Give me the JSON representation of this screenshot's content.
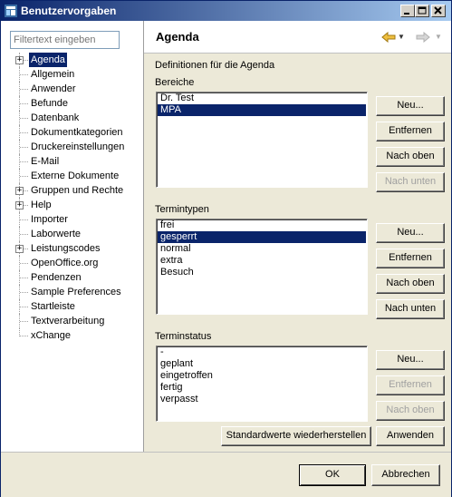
{
  "window": {
    "title": "Benutzervorgaben"
  },
  "filter": {
    "placeholder": "Filtertext eingeben"
  },
  "tree": [
    {
      "label": "Agenda",
      "expandable": true,
      "selected": true
    },
    {
      "label": "Allgemein"
    },
    {
      "label": "Anwender"
    },
    {
      "label": "Befunde"
    },
    {
      "label": "Datenbank"
    },
    {
      "label": "Dokumentkategorien"
    },
    {
      "label": "Druckereinstellungen"
    },
    {
      "label": "E-Mail"
    },
    {
      "label": "Externe Dokumente"
    },
    {
      "label": "Gruppen und Rechte",
      "expandable": true
    },
    {
      "label": "Help",
      "expandable": true
    },
    {
      "label": "Importer"
    },
    {
      "label": "Laborwerte"
    },
    {
      "label": "Leistungscodes",
      "expandable": true
    },
    {
      "label": "OpenOffice.org"
    },
    {
      "label": "Pendenzen"
    },
    {
      "label": "Sample Preferences"
    },
    {
      "label": "Startleiste"
    },
    {
      "label": "Textverarbeitung"
    },
    {
      "label": "xChange"
    }
  ],
  "page": {
    "title": "Agenda",
    "description": "Definitionen für die Agenda",
    "bereiche": {
      "label": "Bereiche",
      "items": [
        "Dr. Test",
        "MPA"
      ],
      "selected": 1
    },
    "termintypen": {
      "label": "Termintypen",
      "items": [
        "frei",
        "gesperrt",
        "normal",
        "extra",
        "Besuch"
      ],
      "selected": 1
    },
    "terminstatus": {
      "label": "Terminstatus",
      "items": [
        "-",
        "geplant",
        "eingetroffen",
        "fertig",
        "verpasst"
      ],
      "selected": -1
    },
    "buttons": {
      "new": "Neu...",
      "remove": "Entfernen",
      "up": "Nach oben",
      "down": "Nach unten"
    },
    "restore_defaults": "Standardwerte wiederherstellen",
    "apply": "Anwenden"
  },
  "footer": {
    "ok": "OK",
    "cancel": "Abbrechen"
  },
  "colors": {
    "selection": "#0a246a",
    "titlebar_start": "#0a246a",
    "titlebar_end": "#a6caf0",
    "panel": "#ece9d8",
    "back_arrow": "#f0c040"
  },
  "icons": {
    "back": "arrow-left-icon",
    "forward": "arrow-right-icon",
    "window": "preferences-window-icon"
  }
}
